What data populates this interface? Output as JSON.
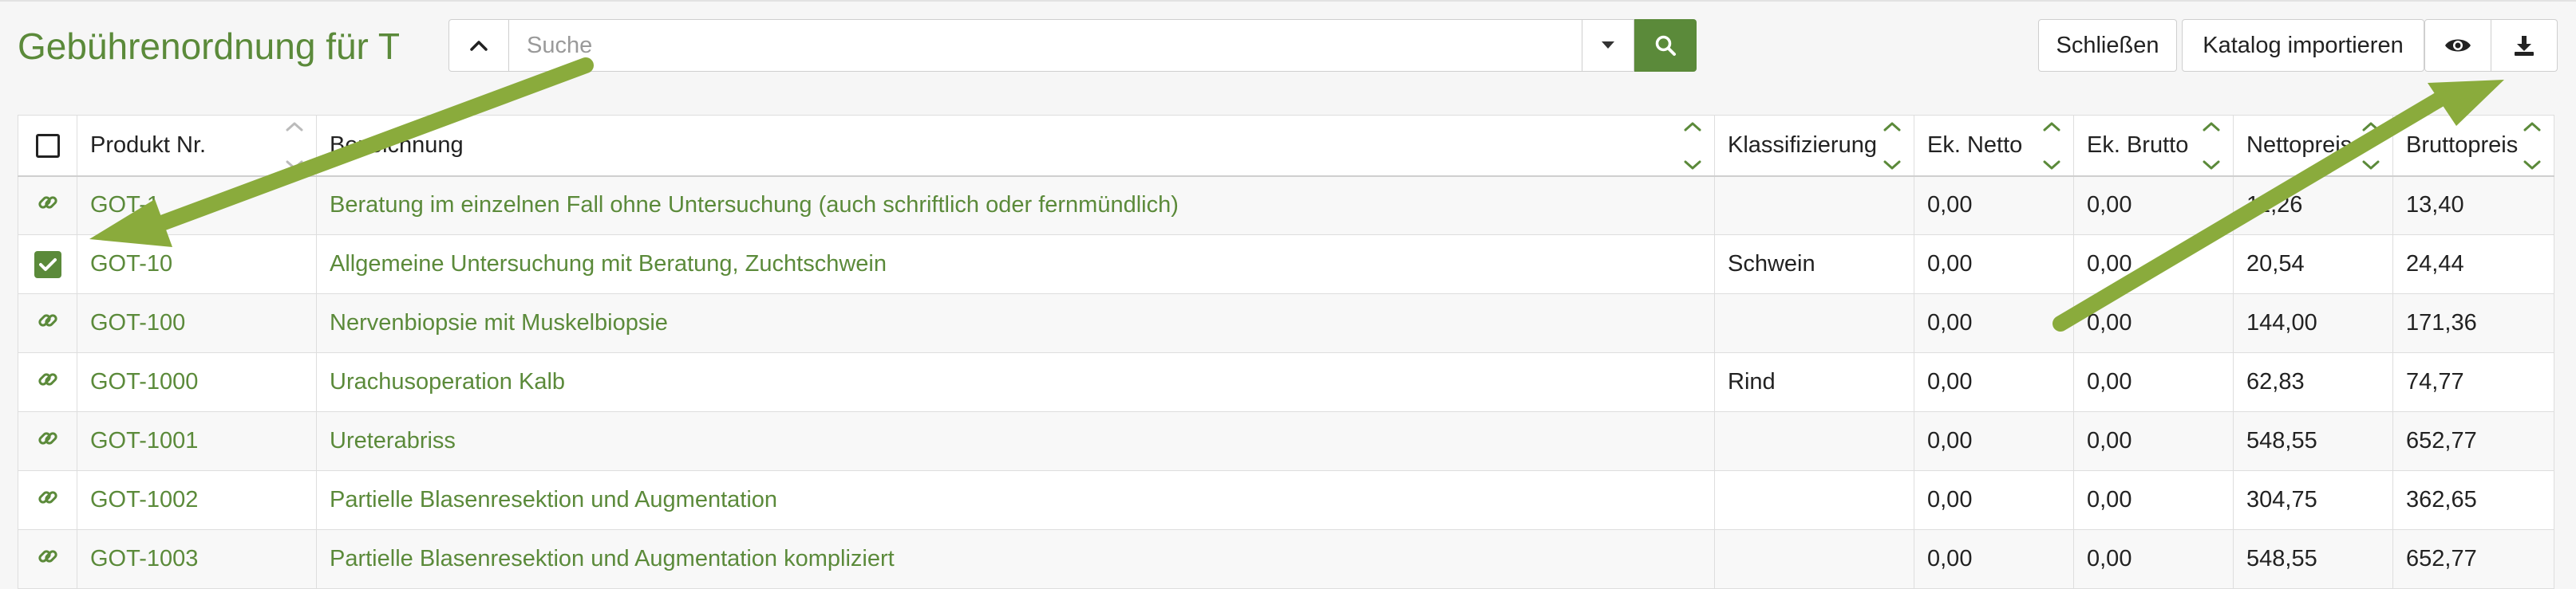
{
  "header": {
    "title": "Gebührenordnung für T",
    "search_placeholder": "Suche",
    "close_label": "Schließen",
    "import_label": "Katalog importieren"
  },
  "table": {
    "columns": [
      "Produkt Nr.",
      "Bezeichnung",
      "Klassifizierung",
      "Ek. Netto",
      "Ek. Brutto",
      "Nettopreis",
      "Bruttopreis"
    ],
    "rows": [
      {
        "nr": "GOT-1",
        "bez": "Beratung im einzelnen Fall ohne Untersuchung (auch schriftlich oder fernmündlich)",
        "klass": "",
        "ekn": "0,00",
        "ekb": "0,00",
        "netto": "11,26",
        "brutto": "13,40",
        "selected": false
      },
      {
        "nr": "GOT-10",
        "bez": "Allgemeine Untersuchung mit Beratung, Zuchtschwein",
        "klass": "Schwein",
        "ekn": "0,00",
        "ekb": "0,00",
        "netto": "20,54",
        "brutto": "24,44",
        "selected": true
      },
      {
        "nr": "GOT-100",
        "bez": "Nervenbiopsie mit Muskelbiopsie",
        "klass": "",
        "ekn": "0,00",
        "ekb": "0,00",
        "netto": "144,00",
        "brutto": "171,36",
        "selected": false
      },
      {
        "nr": "GOT-1000",
        "bez": "Urachusoperation Kalb",
        "klass": "Rind",
        "ekn": "0,00",
        "ekb": "0,00",
        "netto": "62,83",
        "brutto": "74,77",
        "selected": false
      },
      {
        "nr": "GOT-1001",
        "bez": "Ureterabriss",
        "klass": "",
        "ekn": "0,00",
        "ekb": "0,00",
        "netto": "548,55",
        "brutto": "652,77",
        "selected": false
      },
      {
        "nr": "GOT-1002",
        "bez": "Partielle Blasenresektion und Augmentation",
        "klass": "",
        "ekn": "0,00",
        "ekb": "0,00",
        "netto": "304,75",
        "brutto": "362,65",
        "selected": false
      },
      {
        "nr": "GOT-1003",
        "bez": "Partielle Blasenresektion und Augmentation kompliziert",
        "klass": "",
        "ekn": "0,00",
        "ekb": "0,00",
        "netto": "548,55",
        "brutto": "652,77",
        "selected": false
      }
    ]
  },
  "colors": {
    "accent": "#5b8a3a",
    "annotation_arrow": "#8aab3c"
  }
}
